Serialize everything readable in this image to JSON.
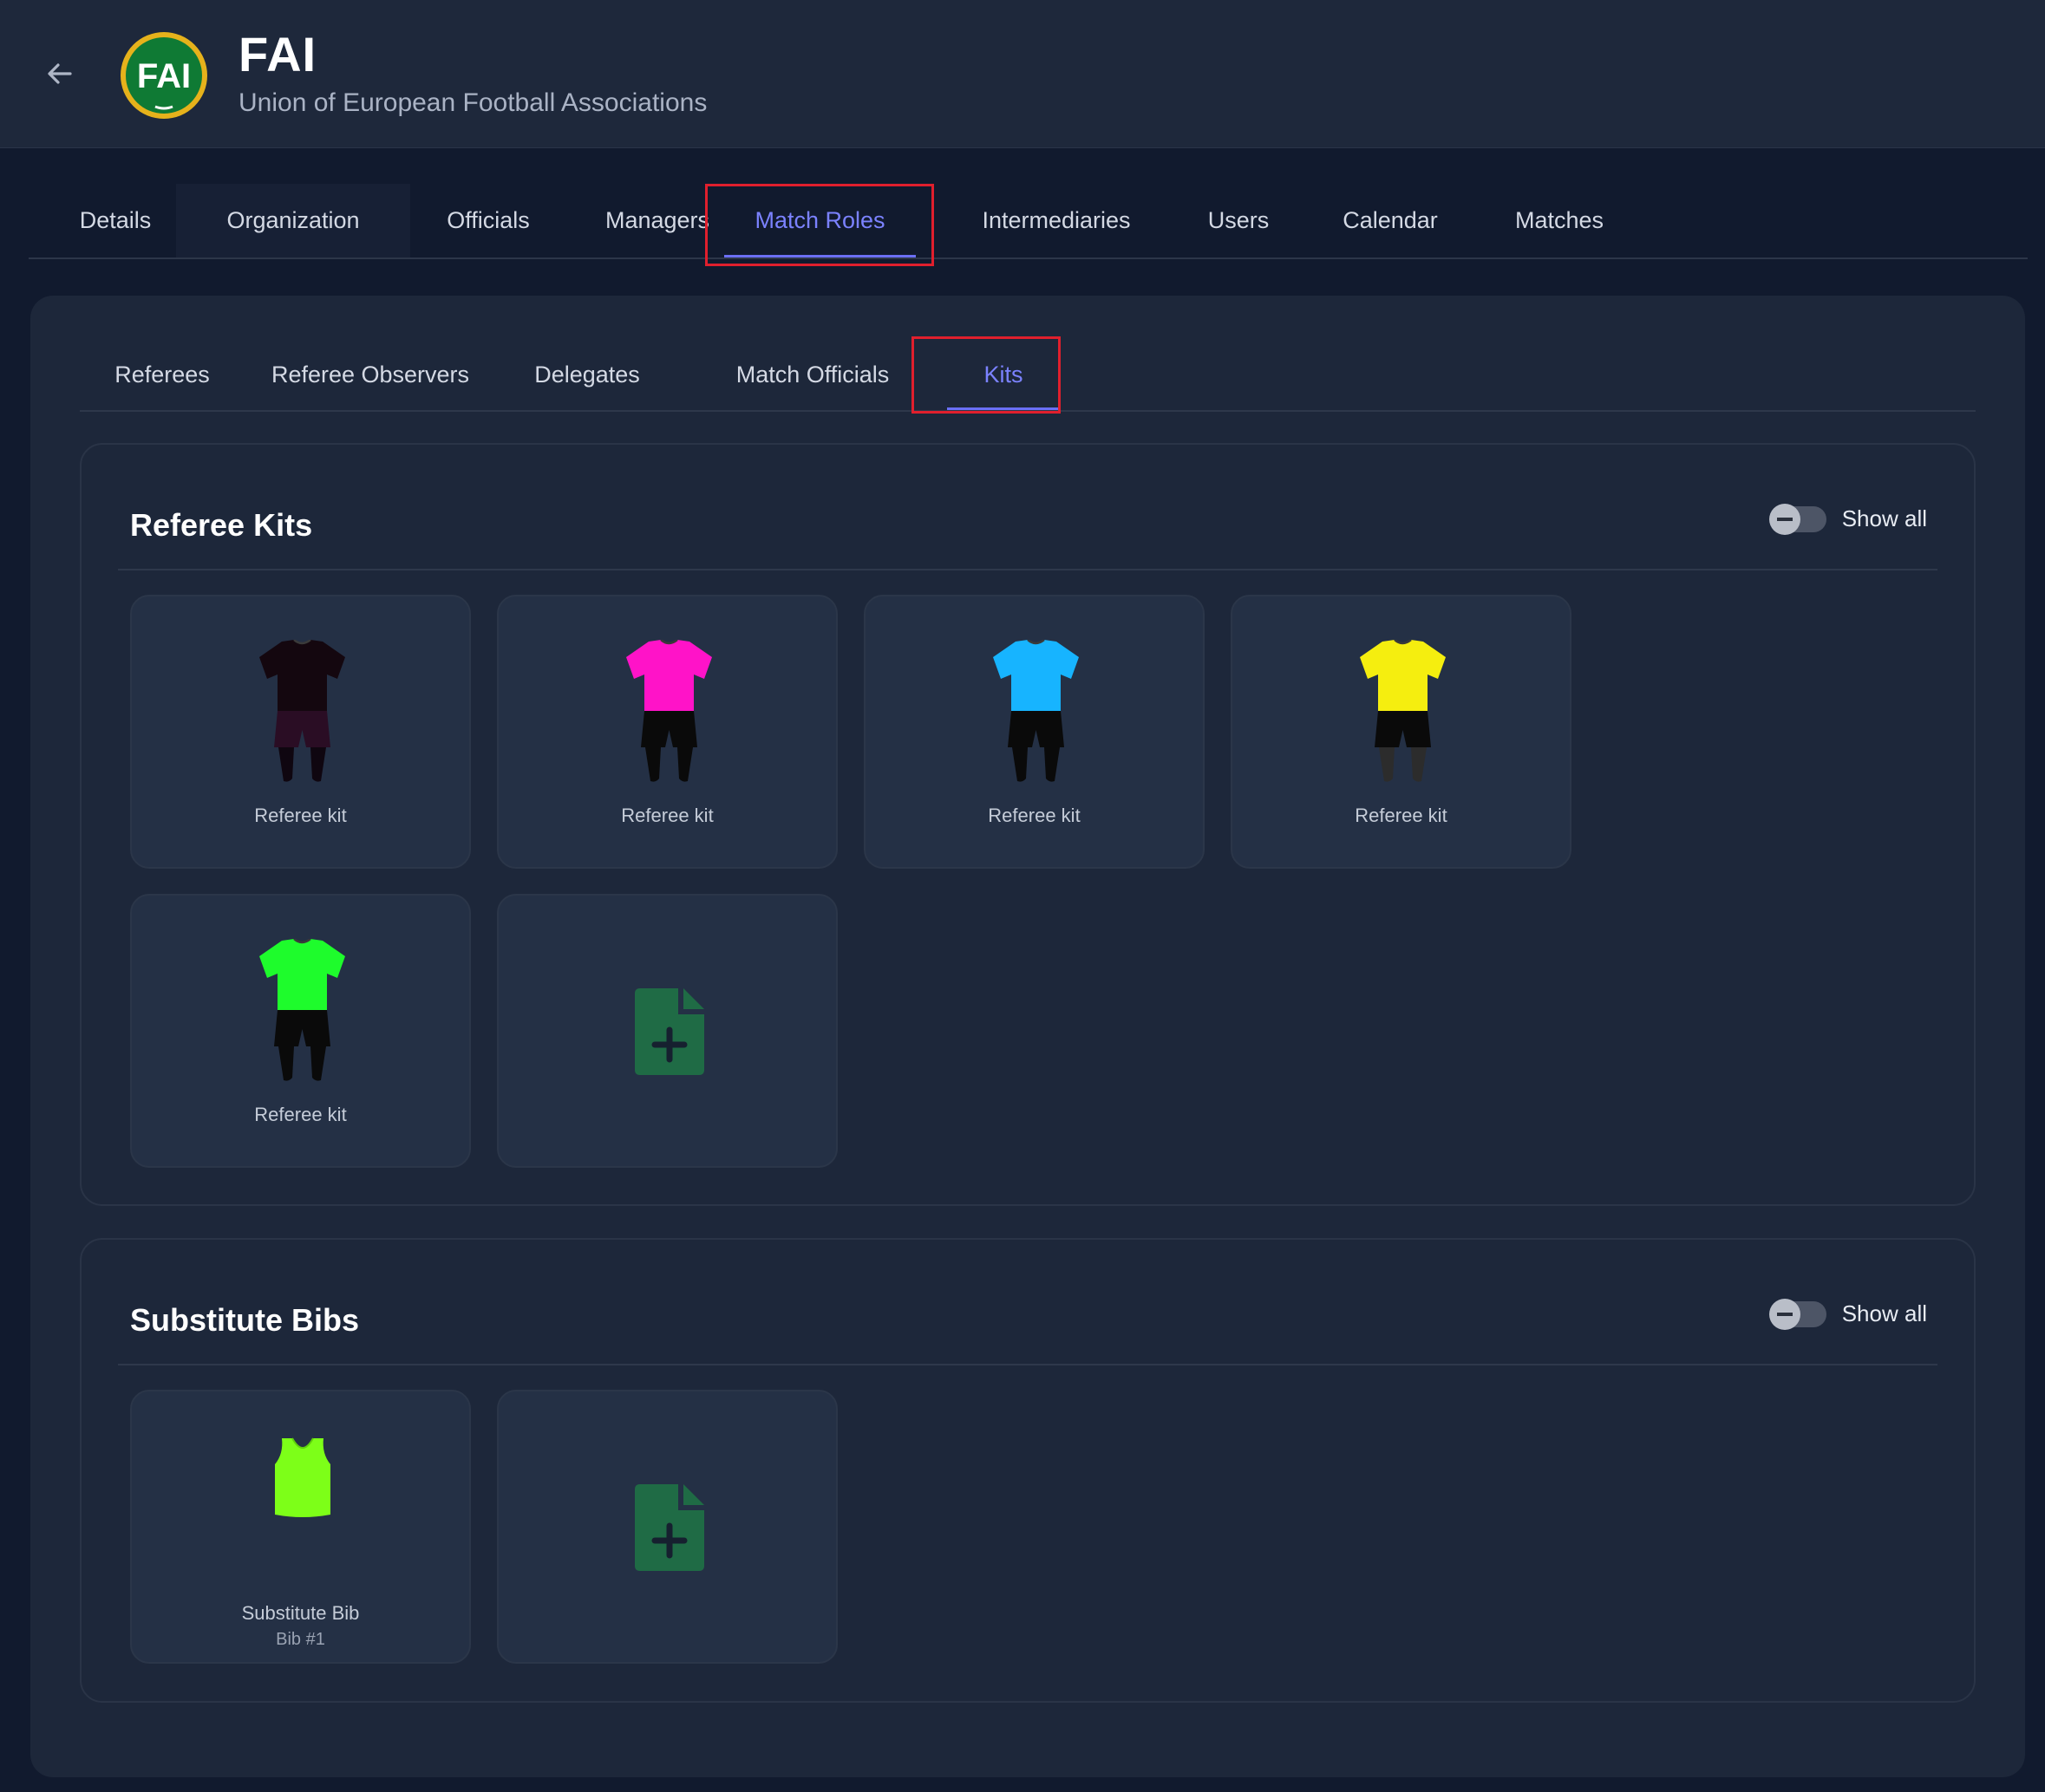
{
  "header": {
    "org_name": "FAI",
    "org_subtitle": "Union of European Football Associations",
    "logo_text": "FAI"
  },
  "top_tabs": [
    {
      "label": "Details"
    },
    {
      "label": "Organization"
    },
    {
      "label": "Officials"
    },
    {
      "label": "Managers"
    },
    {
      "label": "Match Roles",
      "active": true
    },
    {
      "label": "Intermediaries"
    },
    {
      "label": "Users"
    },
    {
      "label": "Calendar"
    },
    {
      "label": "Matches"
    }
  ],
  "sub_tabs": [
    {
      "label": "Referees"
    },
    {
      "label": "Referee Observers"
    },
    {
      "label": "Delegates"
    },
    {
      "label": "Match Officials"
    },
    {
      "label": "Kits",
      "active": true
    }
  ],
  "referee_kits": {
    "title": "Referee Kits",
    "toggle_label": "Show all",
    "toggle_on": false,
    "items": [
      {
        "caption": "Referee kit",
        "shirt_color": "#14070f",
        "shorts_color": "#2a0d24",
        "socks_color": "#0f0610"
      },
      {
        "caption": "Referee kit",
        "shirt_color": "#ff13c8",
        "shorts_color": "#0a0a0a",
        "socks_color": "#0a0a0a"
      },
      {
        "caption": "Referee kit",
        "shirt_color": "#17b4ff",
        "shorts_color": "#0a0a0a",
        "socks_color": "#0a0a0a"
      },
      {
        "caption": "Referee kit",
        "shirt_color": "#f5ee0f",
        "shorts_color": "#0a0a0a",
        "socks_color": "#2c2c2c"
      },
      {
        "caption": "Referee kit",
        "shirt_color": "#1efc2c",
        "shorts_color": "#0a0a0a",
        "socks_color": "#0a0a0a"
      }
    ],
    "add_icon": "file-plus-icon"
  },
  "substitute_bibs": {
    "title": "Substitute Bibs",
    "toggle_label": "Show all",
    "toggle_on": false,
    "items": [
      {
        "caption": "Substitute Bib",
        "subcaption": "Bib #1",
        "bib_color": "#7dff18"
      }
    ],
    "add_icon": "file-plus-icon"
  },
  "colors": {
    "accent": "#7b82ff",
    "highlight_box": "#e01f2d",
    "add_icon": "#1f6b45"
  }
}
